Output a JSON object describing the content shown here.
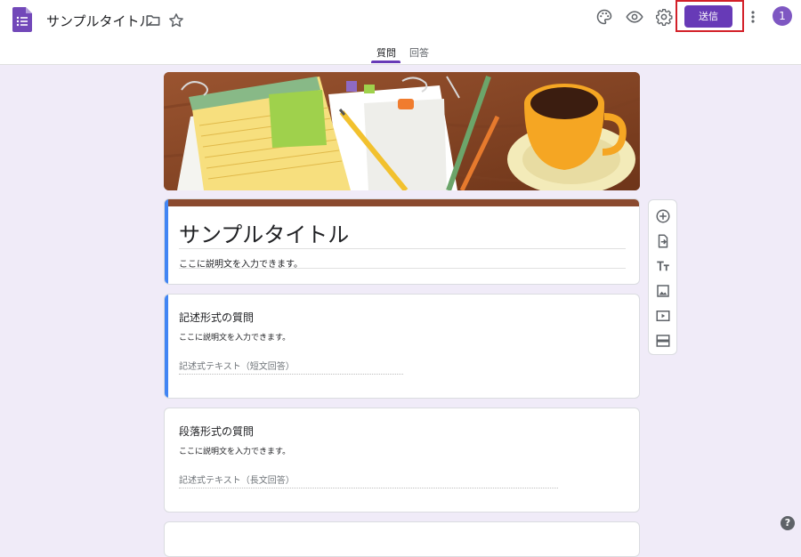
{
  "header": {
    "doc_title": "サンプルタイトル",
    "send_label": "送信",
    "avatar_label": "1",
    "icons": [
      "forms-logo-icon",
      "folder-icon",
      "star-icon",
      "palette-icon",
      "eye-icon",
      "gear-icon",
      "more-vert-icon"
    ]
  },
  "tabs": [
    {
      "label": "質問",
      "active": true
    },
    {
      "label": "回答",
      "active": false
    }
  ],
  "form": {
    "title": "サンプルタイトル",
    "description": "ここに説明文を入力できます。"
  },
  "questions": [
    {
      "title": "記述形式の質問",
      "description": "ここに説明文を入力できます。",
      "placeholder": "記述式テキスト（短文回答）"
    },
    {
      "title": "段落形式の質問",
      "description": "ここに説明文を入力できます。",
      "placeholder": "記述式テキスト（長文回答）"
    }
  ],
  "side_toolbar": [
    "add-question-icon",
    "import-questions-icon",
    "add-title-icon",
    "add-image-icon",
    "add-video-icon",
    "add-section-icon"
  ],
  "help_label": "?",
  "colors": {
    "accent": "#673ab7",
    "background": "#f0ebf8",
    "highlight_border": "#d32029",
    "active_card_strip": "#4285f4",
    "title_card_strip": "#8b4a2f"
  }
}
